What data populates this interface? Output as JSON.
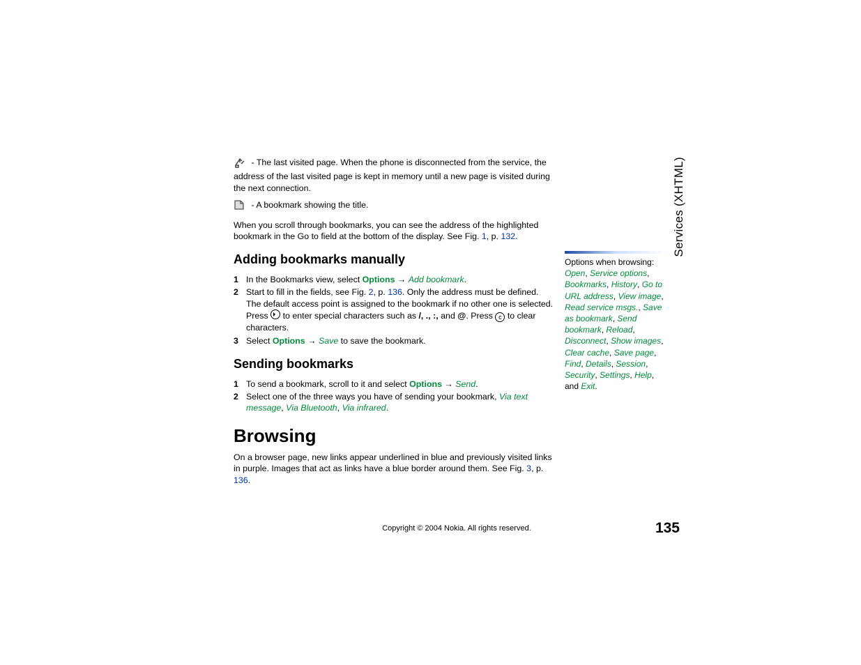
{
  "side_tab": "Services (XHTML)",
  "page_number": "135",
  "copyright": "Copyright © 2004 Nokia. All rights reserved.",
  "intro": {
    "last_visited": " - The last visited page. When the phone is disconnected from the service, the address of the last visited page is kept in memory until a new page is visited during the next connection.",
    "bookmark_title": " - A bookmark showing the title.",
    "scroll_a": "When you scroll through bookmarks, you can see the address of the highlighted bookmark in the Go to field at the bottom of the display. See Fig. ",
    "fig1": "1",
    "scroll_b": ", p. ",
    "p132": "132",
    "dot": "."
  },
  "adding": {
    "heading": "Adding bookmarks manually",
    "s1_a": "In the Bookmarks view, select ",
    "s1_opt": "Options",
    "s1_arrow": " → ",
    "s1_act": "Add bookmark",
    "s1_end": ".",
    "s2_a": "Start to fill in the fields, see Fig. ",
    "s2_fig": "2",
    "s2_b": ", p. ",
    "s2_p": "136",
    "s2_c": ". Only the address must be defined. The default access point is assigned to the bookmark if no other one is selected. Press ",
    "s2_d": " to enter special characters such as ",
    "s2_chars": "/, ., :,",
    "s2_e": " and ",
    "s2_at": "@",
    "s2_f": ". Press ",
    "s2_g": " to clear characters.",
    "s3_a": "Select ",
    "s3_opt": "Options",
    "s3_arrow": " → ",
    "s3_act": "Save",
    "s3_end": " to save the bookmark."
  },
  "sending": {
    "heading": "Sending bookmarks",
    "s1_a": "To send a bookmark, scroll to it and select ",
    "s1_opt": "Options",
    "s1_arrow": " → ",
    "s1_act": "Send",
    "s1_end": ".",
    "s2_a": "Select one of the three ways you have of sending your bookmark, ",
    "s2_o1": "Via text message",
    "s2_o2": "Via Bluetooth",
    "s2_o3": "Via infrared",
    "s2_end": "."
  },
  "browsing": {
    "heading": "Browsing",
    "p_a": "On a browser page, new links appear underlined in blue and previously visited links in purple. Images that act as links have a blue border around them. See Fig. ",
    "fig": "3",
    "p_b": ", p. ",
    "pg": "136",
    "p_c": "."
  },
  "sidebar": {
    "lead": "Options when browsing: ",
    "opts": [
      "Open",
      "Service options",
      "Bookmarks",
      "History",
      "Go to URL address",
      "View image",
      "Read service msgs.",
      "Save as bookmark",
      "Send bookmark",
      "Reload",
      "Disconnect",
      "Show images",
      "Clear cache",
      "Save page",
      "Find",
      "Details",
      "Session",
      "Security",
      "Settings",
      "Help"
    ],
    "tail_a": ", and ",
    "exit": "Exit",
    "tail_b": "."
  }
}
